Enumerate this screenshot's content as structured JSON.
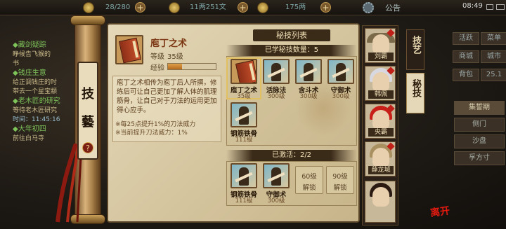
{
  "topbar": {
    "res1": "28/280",
    "res2": "11两251文",
    "res3": "175两",
    "announce": "公告",
    "time": "08:49"
  },
  "quests": [
    {
      "title": "◆藏剑疑踪",
      "lines": [
        "睁候告飞猴的",
        "书"
      ]
    },
    {
      "title": "◆钱庄生意",
      "lines": [
        "给正调钱庄的时",
        "带去一个星宝颛"
      ]
    },
    {
      "title": "◆老木匠的研究",
      "lines": [
        "等待老木匠研究",
        "时间：11:45:16"
      ]
    },
    {
      "title": "◆大年初四",
      "lines": [
        "前往白马寺"
      ]
    }
  ],
  "scroll_label": {
    "t1": "技",
    "t2": "藝",
    "help": "?"
  },
  "item": {
    "name": "庖丁之术",
    "level_label": "等级",
    "level_value": "35级",
    "exp_label": "经验",
    "exp_progress": 0.3,
    "description": "庖丁之术相传为庖丁后人所撰，修练后可让自己更加了解人体的肌理筋骨，让自己对于刀法的运用更加得心应手。",
    "note1": "※每25点提升1%的刀法威力",
    "note2": "※当前提升刀法威力：1%"
  },
  "panel": {
    "title": "秘技列表",
    "learned_header": "已学秘技数量：5",
    "active_header": "已激活：2/2"
  },
  "learned_skills": [
    {
      "name": "庖丁之术",
      "level": "35级"
    },
    {
      "name": "活脉法",
      "level": "300级"
    },
    {
      "name": "含斗术",
      "level": "300级"
    },
    {
      "name": "守御术",
      "level": "300级"
    },
    {
      "name": "钢筋铁骨",
      "level": "111级"
    }
  ],
  "active_skills": [
    {
      "name": "钢筋铁骨",
      "level": "111级"
    },
    {
      "name": "守御术",
      "level": "300级"
    }
  ],
  "locked_slots": [
    {
      "level": "60级",
      "label": "解锁"
    },
    {
      "level": "90级",
      "label": "解锁"
    }
  ],
  "characters": [
    "刘霸",
    "韩佩",
    "央霸",
    "薛龙城"
  ],
  "tabs": {
    "skills": "技艺",
    "secret": "秘技"
  },
  "right_menu": {
    "row1": [
      "活跃",
      "菜单"
    ],
    "row2": [
      "商城",
      "城市"
    ],
    "row3": [
      "背包",
      "25.1"
    ],
    "list": [
      "集誓期",
      "侧门",
      "沙盘",
      "孚方寸"
    ]
  },
  "seal": "离开"
}
